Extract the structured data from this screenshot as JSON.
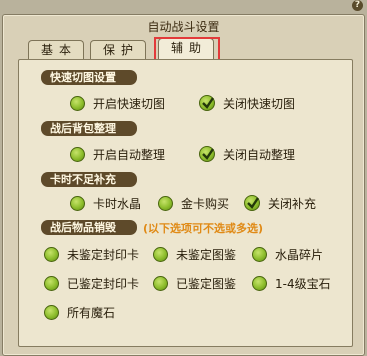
{
  "window": {
    "title": "自动战斗设置",
    "help": "?"
  },
  "tabs": [
    {
      "label": "基本",
      "active": false
    },
    {
      "label": "保护",
      "active": false
    },
    {
      "label": "辅助",
      "active": true
    }
  ],
  "sections": [
    {
      "header": "快速切图设置",
      "options": [
        {
          "label": "开启快速切图",
          "checked": false
        },
        {
          "label": "关闭快速切图",
          "checked": true
        }
      ]
    },
    {
      "header": "战后背包整理",
      "options": [
        {
          "label": "开启自动整理",
          "checked": false
        },
        {
          "label": "关闭自动整理",
          "checked": true
        }
      ]
    },
    {
      "header": "卡时不足补充",
      "options": [
        {
          "label": "卡时水晶",
          "checked": false
        },
        {
          "label": "金卡购买",
          "checked": false
        },
        {
          "label": "关闭补充",
          "checked": true
        }
      ]
    },
    {
      "header": "战后物品销毁",
      "note": "(以下选项可不选或多选)",
      "options": [
        {
          "label": "未鉴定封印卡",
          "checked": false
        },
        {
          "label": "未鉴定图鉴",
          "checked": false
        },
        {
          "label": "水晶碎片",
          "checked": false
        },
        {
          "label": "已鉴定封印卡",
          "checked": false
        },
        {
          "label": "已鉴定图鉴",
          "checked": false
        },
        {
          "label": "1-4级宝石",
          "checked": false
        },
        {
          "label": "所有魔石",
          "checked": false
        }
      ]
    }
  ],
  "colors": {
    "accent": "#8dbd2c",
    "header_bg": "#5e4a2a",
    "note": "#e08a16",
    "highlight": "#e23a3a"
  }
}
